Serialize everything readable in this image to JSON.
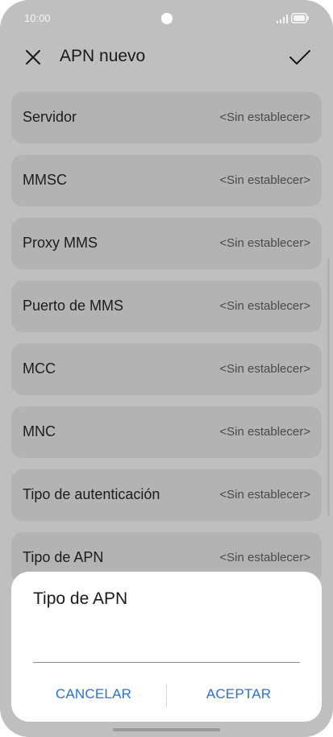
{
  "status_bar": {
    "time": "10:00",
    "icons": [
      "camera-dot",
      "signal-icon",
      "battery-icon"
    ]
  },
  "app_bar": {
    "title": "APN nuevo",
    "close_icon": "close-icon",
    "confirm_icon": "check-icon"
  },
  "settings": [
    {
      "label": "Servidor",
      "value": "<Sin establecer>"
    },
    {
      "label": "MMSC",
      "value": "<Sin establecer>"
    },
    {
      "label": "Proxy MMS",
      "value": "<Sin establecer>"
    },
    {
      "label": "Puerto de MMS",
      "value": "<Sin establecer>"
    },
    {
      "label": "MCC",
      "value": "<Sin establecer>"
    },
    {
      "label": "MNC",
      "value": "<Sin establecer>"
    },
    {
      "label": "Tipo de autenticación",
      "value": "<Sin establecer>"
    },
    {
      "label": "Tipo de APN",
      "value": "<Sin establecer>"
    }
  ],
  "dialog": {
    "title": "Tipo de APN",
    "input_value": "",
    "cancel_label": "CANCELAR",
    "accept_label": "ACEPTAR"
  },
  "colors": {
    "overlay": "#bfbfbf",
    "row_background": "#b3b3b3",
    "dialog_background": "#ffffff",
    "accent": "#2a6fdb"
  }
}
